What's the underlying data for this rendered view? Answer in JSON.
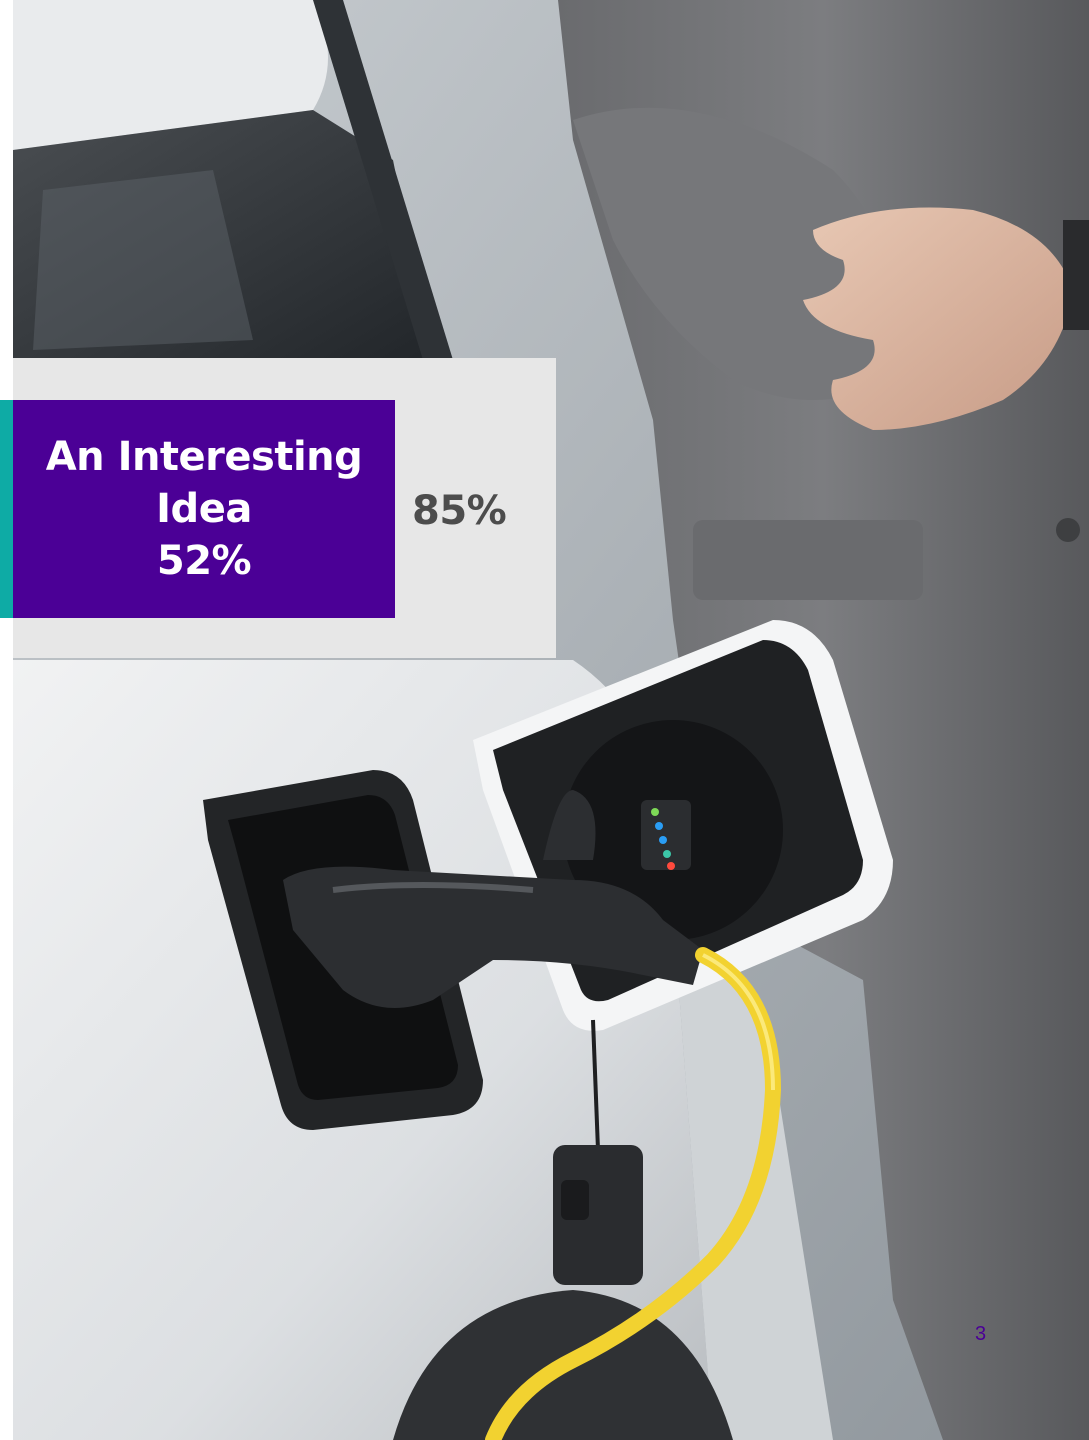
{
  "slide": {
    "callout": {
      "line1": "An Interesting",
      "line2": "Idea",
      "line3": "52%"
    },
    "side_stat": "85%",
    "page_number": "3"
  },
  "colors": {
    "callout_background": "#4b0096",
    "accent_bar": "#0eaba5",
    "card_background": "#e7e7e7",
    "side_stat_text": "#4d4d4d",
    "cable": "#f2d230"
  },
  "photo": {
    "subject": "man in grey suit charging white electric car with yellow cable"
  }
}
